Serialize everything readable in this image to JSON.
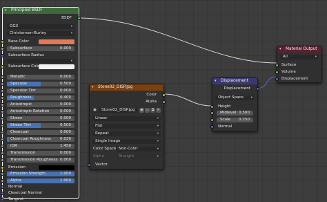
{
  "colors": {
    "shader_header": "#3c6a3a",
    "texture_header": "#7a4010",
    "vector_header": "#3a3a72",
    "output_header": "#5c2030",
    "socket_green": "#63c763",
    "socket_yellow": "#c7c729",
    "socket_grey": "#a1a1a1",
    "socket_purple": "#6363c7",
    "base_color_swatch": "#e27a58",
    "subsurface_color_swatch": "#f2f2f2",
    "emission_swatch": "#000000",
    "field_fill": "#4772b3"
  },
  "bsdf_node": {
    "title": "Principled BSDF",
    "output": "BSDF",
    "distribution": "GGX",
    "subsurface_method": "Christensen-Burley",
    "rows": {
      "base_color": "Base Color",
      "subsurface_label": "Subsurface",
      "subsurface_value": "0.000",
      "subsurface_radius": "Subsurface Radius",
      "subsurface_color": "Subsurface Color",
      "metallic_label": "Metallic",
      "metallic_value": "0.000",
      "specular_label": "Specular",
      "specular_value": "0.500",
      "specular_tint_label": "Specular Tint",
      "specular_tint_value": "0.000",
      "roughness_label": "Roughness",
      "roughness_value": "0.400",
      "anisotropic_label": "Anisotropic",
      "anisotropic_value": "0.000",
      "anisotropic_rotation_label": "Anisotropic Rotation",
      "anisotropic_rotation_value": "0.000",
      "sheen_label": "Sheen",
      "sheen_value": "0.000",
      "sheen_tint_label": "Sheen Tint",
      "sheen_tint_value": "0.500",
      "clearcoat_label": "Clearcoat",
      "clearcoat_value": "0.000",
      "clearcoat_roughness_label": "Clearcoat Roughness",
      "clearcoat_roughness_value": "0.030",
      "ior_label": "IOR",
      "ior_value": "1.450",
      "transmission_label": "Transmission",
      "transmission_value": "0.000",
      "transmission_roughness_label": "Transmission Roughness",
      "transmission_roughness_value": "0.000",
      "emission": "Emission",
      "emission_strength_label": "Emission Strength",
      "emission_strength_value": "1.000",
      "alpha_label": "Alpha",
      "alpha_value": "1.000",
      "normal": "Normal",
      "clearcoat_normal": "Clearcoat Normal",
      "tangent": "Tangent"
    },
    "fill_fractions": {
      "specular": 0.5,
      "roughness": 0.4,
      "sheen_tint": 0.5,
      "clearcoat_roughness": 0.03,
      "emission_strength": 1.0,
      "alpha": 1.0
    }
  },
  "texture_node": {
    "title": "Stone02_DISP.jpg",
    "outputs": {
      "color": "Color",
      "alpha": "Alpha"
    },
    "image_name": "Stone02_DISP.jpg",
    "interpolation": "Linear",
    "projection": "Flat",
    "extension": "Repeat",
    "source": "Single Image",
    "color_space_label": "Color Space",
    "color_space_value": "Non-Color",
    "alpha_label": "Alpha",
    "alpha_value": "Straight",
    "vector": "Vector"
  },
  "displacement_node": {
    "title": "Displacement",
    "output": "Displacement",
    "space": "Object Space",
    "height": "Height",
    "midlevel_label": "Midlevel",
    "midlevel_value": "0.500",
    "scale_label": "Scale",
    "scale_value": "0.250",
    "normal": "Normal"
  },
  "output_node": {
    "title": "Material Output",
    "target": "All",
    "surface": "Surface",
    "volume": "Volume",
    "displacement": "Displacement"
  }
}
